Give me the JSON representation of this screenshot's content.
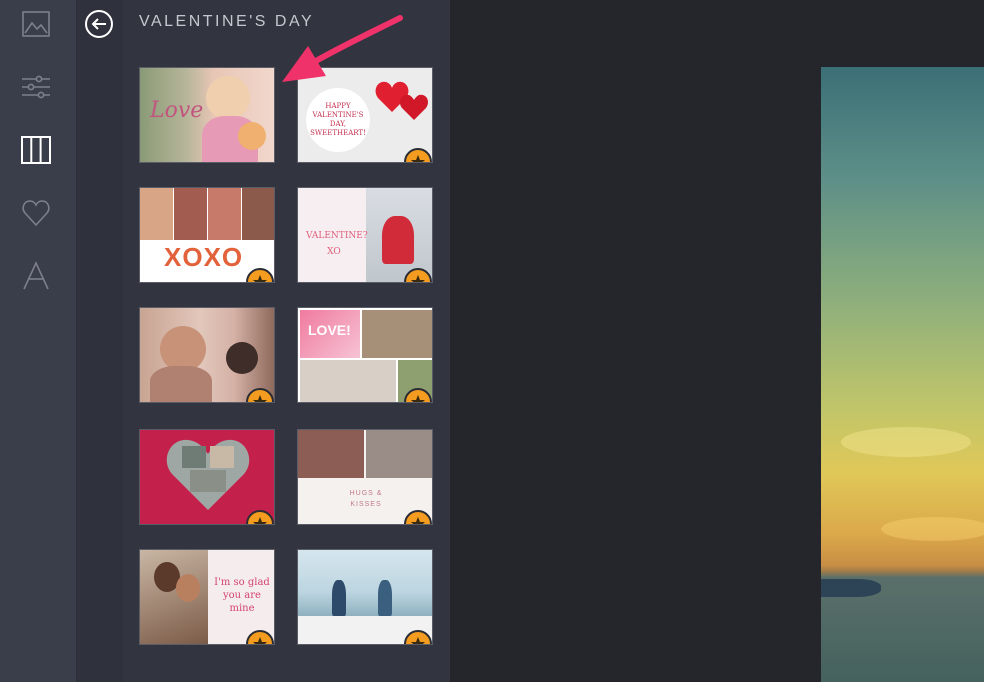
{
  "panel": {
    "title": "VALENTINE'S DAY"
  },
  "rail": {
    "items": [
      {
        "name": "image-icon",
        "active": false
      },
      {
        "name": "sliders-icon",
        "active": false
      },
      {
        "name": "frames-icon",
        "active": true
      },
      {
        "name": "heart-icon",
        "active": false
      },
      {
        "name": "text-icon",
        "active": false
      }
    ]
  },
  "templates": [
    {
      "name": "template-love-girl-kitten",
      "premium": false,
      "text": "Love"
    },
    {
      "name": "template-happy-valentines-sweetheart",
      "premium": true,
      "text": "HAPPY VALENTINE'S DAY, SWEETHEART!"
    },
    {
      "name": "template-xoxo-kids",
      "premium": true,
      "text": "XOXO"
    },
    {
      "name": "template-valentine-xo",
      "premium": true,
      "text": "VALENTINE? XO"
    },
    {
      "name": "template-father-daughter",
      "premium": true,
      "text": ""
    },
    {
      "name": "template-love-collage",
      "premium": true,
      "text": "LOVE!"
    },
    {
      "name": "template-heart-collage",
      "premium": true,
      "text": ""
    },
    {
      "name": "template-hugs-kisses",
      "premium": true,
      "text": "HUGS & KISSES"
    },
    {
      "name": "template-glad-you-are-mine",
      "premium": true,
      "text": "I'm so glad you are mine"
    },
    {
      "name": "template-couple-beach",
      "premium": true,
      "text": ""
    }
  ],
  "colors": {
    "accent": "#f39c1f",
    "annotation_arrow": "#f0326a",
    "sidebar": "#3a3d4a",
    "panel": "#32353f",
    "canvas": "#25262c"
  }
}
